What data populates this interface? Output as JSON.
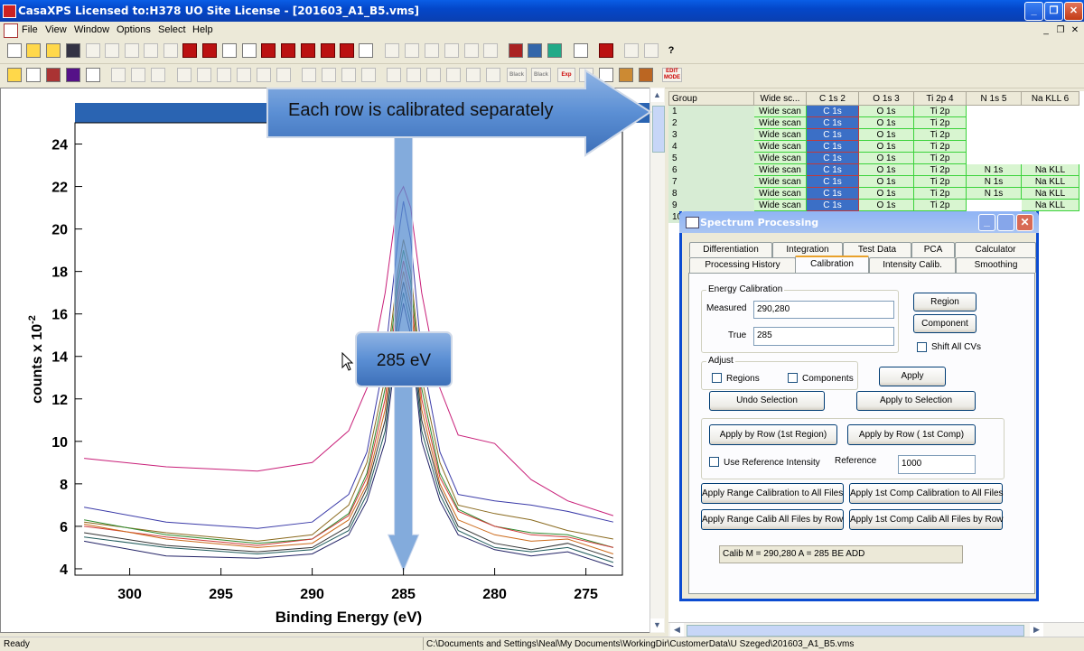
{
  "window": {
    "title": "CasaXPS Licensed to:H378 UO Site License - [201603_A1_B5.vms]",
    "min_glyph": "_",
    "max_glyph": "❐",
    "close_glyph": "✕"
  },
  "menu": {
    "items": [
      "File",
      "View",
      "Window",
      "Options",
      "Select",
      "Help"
    ],
    "mdi_min": "_",
    "mdi_restore": "❐",
    "mdi_close": "✕"
  },
  "toolbar2_text": {
    "black": "Black",
    "black2": "Black",
    "exp": "Exp",
    "edit_mode": "EDIT MODE"
  },
  "callouts": {
    "rows": "Each row is calibrated separately",
    "energy": "285 eV"
  },
  "chart_data": {
    "type": "line",
    "xlabel": "Binding Energy (eV)",
    "ylabel": "counts x 10",
    "ylabel_exponent": "-2",
    "x_reversed": true,
    "xlim": [
      303,
      273
    ],
    "ylim": [
      3.7,
      25
    ],
    "x_ticks": [
      300,
      295,
      290,
      285,
      280,
      275
    ],
    "y_ticks": [
      4,
      6,
      8,
      10,
      12,
      14,
      16,
      18,
      20,
      22,
      24
    ],
    "series": [
      {
        "color": "#c81e78",
        "points": [
          [
            302.5,
            9.2
          ],
          [
            298,
            8.8
          ],
          [
            293,
            8.6
          ],
          [
            290,
            9.0
          ],
          [
            288,
            10.5
          ],
          [
            287,
            12.5
          ],
          [
            286,
            17
          ],
          [
            285.3,
            21.5
          ],
          [
            285,
            22
          ],
          [
            284.6,
            21
          ],
          [
            284,
            17
          ],
          [
            283,
            12.5
          ],
          [
            282,
            10.3
          ],
          [
            280,
            9.9
          ],
          [
            278,
            8.2
          ],
          [
            276,
            7.2
          ],
          [
            273.5,
            6.5
          ]
        ]
      },
      {
        "color": "#3a3aa8",
        "points": [
          [
            302.5,
            6.9
          ],
          [
            298,
            6.2
          ],
          [
            293,
            5.9
          ],
          [
            290,
            6.2
          ],
          [
            288,
            7.5
          ],
          [
            287,
            9.5
          ],
          [
            286,
            14
          ],
          [
            285.3,
            19.5
          ],
          [
            285,
            21.3
          ],
          [
            284.6,
            19.5
          ],
          [
            284,
            14
          ],
          [
            283,
            9.5
          ],
          [
            282,
            7.5
          ],
          [
            280,
            7.2
          ],
          [
            278,
            7.0
          ],
          [
            276,
            6.7
          ],
          [
            273.5,
            6.2
          ]
        ]
      },
      {
        "color": "#8a6a1e",
        "points": [
          [
            302.5,
            6.2
          ],
          [
            298,
            5.7
          ],
          [
            293,
            5.3
          ],
          [
            290,
            5.6
          ],
          [
            288,
            7.0
          ],
          [
            287,
            9.0
          ],
          [
            286,
            13
          ],
          [
            285.3,
            18
          ],
          [
            285,
            19.5
          ],
          [
            284.6,
            18
          ],
          [
            284,
            13
          ],
          [
            283,
            9.0
          ],
          [
            282,
            7.0
          ],
          [
            280,
            6.6
          ],
          [
            278,
            6.3
          ],
          [
            276,
            5.8
          ],
          [
            273.5,
            5.4
          ]
        ]
      },
      {
        "color": "#2e8a2e",
        "points": [
          [
            302.5,
            6.3
          ],
          [
            298,
            5.6
          ],
          [
            293,
            5.2
          ],
          [
            290,
            5.4
          ],
          [
            288,
            6.6
          ],
          [
            287,
            8.5
          ],
          [
            286,
            12.5
          ],
          [
            285.3,
            17.5
          ],
          [
            285,
            19
          ],
          [
            284.6,
            17.5
          ],
          [
            284,
            12.5
          ],
          [
            283,
            8.5
          ],
          [
            282,
            6.8
          ],
          [
            280,
            6.0
          ],
          [
            278,
            5.7
          ],
          [
            276,
            5.6
          ],
          [
            273.5,
            5.0
          ]
        ]
      },
      {
        "color": "#d03a3a",
        "points": [
          [
            302.5,
            6.0
          ],
          [
            298,
            5.5
          ],
          [
            293,
            5.1
          ],
          [
            290,
            5.4
          ],
          [
            288,
            6.5
          ],
          [
            287,
            8.3
          ],
          [
            286,
            12
          ],
          [
            285.3,
            17
          ],
          [
            285,
            18.5
          ],
          [
            284.6,
            17
          ],
          [
            284,
            12
          ],
          [
            283,
            8.3
          ],
          [
            282,
            6.7
          ],
          [
            280,
            6.0
          ],
          [
            278,
            5.6
          ],
          [
            276,
            5.5
          ],
          [
            273.5,
            5.0
          ]
        ]
      },
      {
        "color": "#cc6a1a",
        "points": [
          [
            302.5,
            6.1
          ],
          [
            298,
            5.4
          ],
          [
            293,
            5.0
          ],
          [
            290,
            5.2
          ],
          [
            288,
            6.3
          ],
          [
            287,
            8.0
          ],
          [
            286,
            11.5
          ],
          [
            285.3,
            16.5
          ],
          [
            285,
            18
          ],
          [
            284.6,
            16.5
          ],
          [
            284,
            11.5
          ],
          [
            283,
            8.0
          ],
          [
            282,
            6.3
          ],
          [
            280,
            5.6
          ],
          [
            278,
            5.3
          ],
          [
            276,
            5.4
          ],
          [
            273.5,
            4.7
          ]
        ]
      },
      {
        "color": "#333333",
        "points": [
          [
            302.5,
            5.7
          ],
          [
            298,
            5.1
          ],
          [
            293,
            4.8
          ],
          [
            290,
            5.0
          ],
          [
            288,
            6.0
          ],
          [
            287,
            7.8
          ],
          [
            286,
            11
          ],
          [
            285.3,
            16
          ],
          [
            285,
            17.5
          ],
          [
            284.6,
            16
          ],
          [
            284,
            11
          ],
          [
            283,
            7.8
          ],
          [
            282,
            6.0
          ],
          [
            280,
            5.2
          ],
          [
            278,
            4.9
          ],
          [
            276,
            5.2
          ],
          [
            273.5,
            4.5
          ]
        ]
      },
      {
        "color": "#1e5a5a",
        "points": [
          [
            302.5,
            5.5
          ],
          [
            298,
            5.0
          ],
          [
            293,
            4.7
          ],
          [
            290,
            4.9
          ],
          [
            288,
            5.8
          ],
          [
            287,
            7.5
          ],
          [
            286,
            10.5
          ],
          [
            285.3,
            15.5
          ],
          [
            285,
            17
          ],
          [
            284.6,
            15.5
          ],
          [
            284,
            10.5
          ],
          [
            283,
            7.5
          ],
          [
            282,
            5.8
          ],
          [
            280,
            5.0
          ],
          [
            278,
            4.8
          ],
          [
            276,
            5.0
          ],
          [
            273.5,
            4.3
          ]
        ]
      },
      {
        "color": "#222266",
        "points": [
          [
            302.5,
            5.3
          ],
          [
            298,
            4.6
          ],
          [
            293,
            4.5
          ],
          [
            290,
            4.7
          ],
          [
            288,
            5.6
          ],
          [
            287,
            7.2
          ],
          [
            286,
            10
          ],
          [
            285.3,
            15
          ],
          [
            285,
            16.5
          ],
          [
            284.6,
            15
          ],
          [
            284,
            10
          ],
          [
            283,
            7.2
          ],
          [
            282,
            5.6
          ],
          [
            280,
            4.9
          ],
          [
            278,
            4.6
          ],
          [
            276,
            4.8
          ],
          [
            273.5,
            4.1
          ]
        ]
      }
    ]
  },
  "grid": {
    "headers": [
      "Group",
      "Wide sc...",
      "C 1s 2",
      "O 1s 3",
      "Ti 2p 4",
      "N 1s 5",
      "Na KLL 6"
    ],
    "rows": [
      {
        "group": "1",
        "cells": [
          "Wide scan",
          "C 1s",
          "O 1s",
          "Ti 2p",
          "",
          ""
        ]
      },
      {
        "group": "2",
        "cells": [
          "Wide scan",
          "C 1s",
          "O 1s",
          "Ti 2p",
          "",
          ""
        ]
      },
      {
        "group": "3",
        "cells": [
          "Wide scan",
          "C 1s",
          "O 1s",
          "Ti 2p",
          "",
          ""
        ]
      },
      {
        "group": "4",
        "cells": [
          "Wide scan",
          "C 1s",
          "O 1s",
          "Ti 2p",
          "",
          ""
        ]
      },
      {
        "group": "5",
        "cells": [
          "Wide scan",
          "C 1s",
          "O 1s",
          "Ti 2p",
          "",
          ""
        ]
      },
      {
        "group": "6",
        "cells": [
          "Wide scan",
          "C 1s",
          "O 1s",
          "Ti 2p",
          "N 1s",
          "Na KLL"
        ]
      },
      {
        "group": "7",
        "cells": [
          "Wide scan",
          "C 1s",
          "O 1s",
          "Ti 2p",
          "N 1s",
          "Na KLL"
        ]
      },
      {
        "group": "8",
        "cells": [
          "Wide scan",
          "C 1s",
          "O 1s",
          "Ti 2p",
          "N 1s",
          "Na KLL"
        ]
      },
      {
        "group": "9",
        "cells": [
          "Wide scan",
          "C 1s",
          "O 1s",
          "Ti 2p",
          "",
          "Na KLL"
        ]
      },
      {
        "group": "10",
        "cells": [
          "",
          "",
          "",
          "",
          "",
          ""
        ]
      }
    ]
  },
  "dialog": {
    "title": "Spectrum Processing",
    "tabs_row1": [
      "Differentiation",
      "Integration",
      "Test Data",
      "PCA",
      "Calculator"
    ],
    "tabs_row2": [
      "Processing History",
      "Calibration",
      "Intensity Calib.",
      "Smoothing"
    ],
    "active_tab": "Calibration",
    "energy_group": "Energy Calibration",
    "measured_label": "Measured",
    "measured_value": "290,280",
    "true_label": "True",
    "true_value": "285",
    "region_btn": "Region",
    "component_btn": "Component",
    "shift_all": "Shift All CVs",
    "adjust_group": "Adjust",
    "regions_chk": "Regions",
    "components_chk": "Components",
    "apply_btn": "Apply",
    "undo_btn": "Undo Selection",
    "apply_sel_btn": "Apply to Selection",
    "apply_row_region": "Apply by Row (1st Region)",
    "apply_row_comp": "Apply by Row ( 1st Comp)",
    "use_ref": "Use Reference Intensity",
    "reference_label": "Reference",
    "reference_value": "1000",
    "range_all": "Apply Range Calibration to All Files",
    "comp_all": "Apply 1st Comp Calibration to All Files",
    "range_row": "Apply Range Calib All Files by Row",
    "comp_row": "Apply 1st Comp Calib All Files by Row",
    "result": "Calib M = 290,280 A = 285 BE ADD"
  },
  "status": {
    "left": "Ready",
    "path": "C:\\Documents and Settings\\Neal\\My Documents\\WorkingDir\\CustomerData\\U Szeged\\201603_A1_B5.vms"
  }
}
